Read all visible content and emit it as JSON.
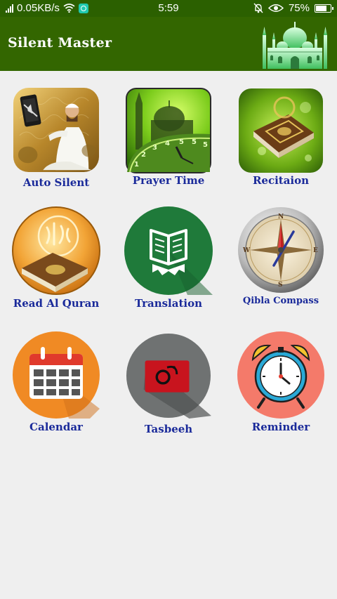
{
  "status_bar": {
    "network_speed": "0.05KB/s",
    "time": "5:59",
    "battery": "75%"
  },
  "app_bar": {
    "title": "Silent Master"
  },
  "menu": [
    {
      "label": "Auto Silent"
    },
    {
      "label": "Prayer Time"
    },
    {
      "label": "Recitaion"
    },
    {
      "label": "Read Al Quran"
    },
    {
      "label": "Translation"
    },
    {
      "label": "Qibla Compass"
    },
    {
      "label": "Calendar"
    },
    {
      "label": "Tasbeeh"
    },
    {
      "label": "Reminder"
    }
  ],
  "colors": {
    "status_bar": "#2b6000",
    "app_bar": "#336600",
    "background": "#efefef",
    "label_text": "#1a2a9a"
  },
  "icons": [
    "praying-man-icon",
    "prayer-clock-icon",
    "quran-icon",
    "read-quran-icon",
    "book-icon",
    "compass-icon",
    "calendar-icon",
    "tasbeeh-icon",
    "alarm-clock-icon"
  ]
}
